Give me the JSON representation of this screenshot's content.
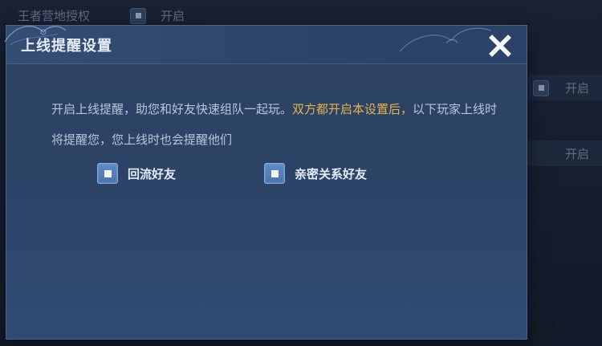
{
  "background": {
    "top_item": {
      "label": "王者营地授权",
      "value": "开启"
    },
    "right_values": [
      "开启",
      "开启"
    ]
  },
  "dialog": {
    "title": "上线提醒设置",
    "close_label": "关闭",
    "description_part1": "开启上线提醒，助您和好友快速组队一起玩。",
    "description_highlight": "双方都开启本设置后，",
    "description_part2": "以下玩家上线时将提醒您，您上线时也会提醒他们",
    "options": [
      {
        "label": "回流好友",
        "checked": true
      },
      {
        "label": "亲密关系好友",
        "checked": true
      }
    ],
    "highlight_color": "#e8b44a",
    "accent_color": "#4a74ad"
  }
}
